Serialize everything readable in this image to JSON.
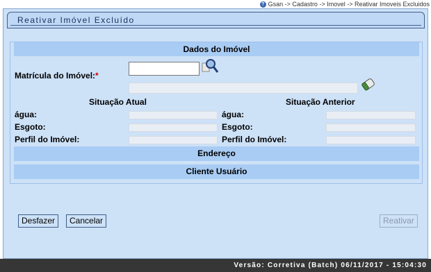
{
  "breadcrumb": {
    "text": "Gsan -> Cadastro -> Imovel -> Reativar Imoveis Excluidos"
  },
  "page": {
    "title": "Reativar Imóvel Excluído"
  },
  "dados": {
    "header": "Dados do Imóvel",
    "matricula_label": "Matrícula do Imóvel:",
    "required_mark": "*",
    "matricula_value": ""
  },
  "situacao_atual": {
    "header": "Situação Atual",
    "agua_label": "água:",
    "esgoto_label": "Esgoto:",
    "perfil_label": "Perfil do Imóvel:"
  },
  "situacao_anterior": {
    "header": "Situação Anterior",
    "agua_label": "água:",
    "esgoto_label": "Esgoto:",
    "perfil_label": "Perfil do Imóvel:"
  },
  "sections": {
    "endereco": "Endereço",
    "cliente": "Cliente Usuário"
  },
  "buttons": {
    "desfazer": "Desfazer",
    "cancelar": "Cancelar",
    "reativar": "Reativar"
  },
  "footer": {
    "version": "Versão: Corretiva (Batch) 06/11/2017 - 15:04:30"
  },
  "icons": {
    "help": "help-icon",
    "search": "magnifier-icon",
    "clear": "eraser-icon"
  },
  "colors": {
    "panel": "#cde1f7",
    "header": "#a9ccf4",
    "footer": "#363636",
    "required": "#cc0000"
  }
}
